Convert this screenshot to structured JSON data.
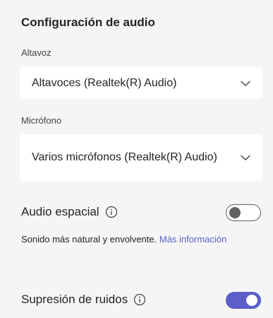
{
  "section": {
    "title": "Configuración de audio"
  },
  "speaker": {
    "label": "Altavoz",
    "value": "Altavoces (Realtek(R) Audio)",
    "icon": "chevron-down-icon"
  },
  "microphone": {
    "label": "Micrófono",
    "value": "Varios micrófonos (Realtek(R) Audio)",
    "icon": "chevron-down-icon"
  },
  "spatial_audio": {
    "label": "Audio espacial",
    "info_icon": "info-icon",
    "enabled": false,
    "description": "Sonido más natural y envolvente.",
    "link": "Más información"
  },
  "noise_suppression": {
    "label": "Supresión de ruidos",
    "info_icon": "info-icon",
    "enabled": true
  },
  "colors": {
    "accent": "#5b5fc7",
    "background": "#f5f5f5",
    "surface": "#ffffff"
  }
}
